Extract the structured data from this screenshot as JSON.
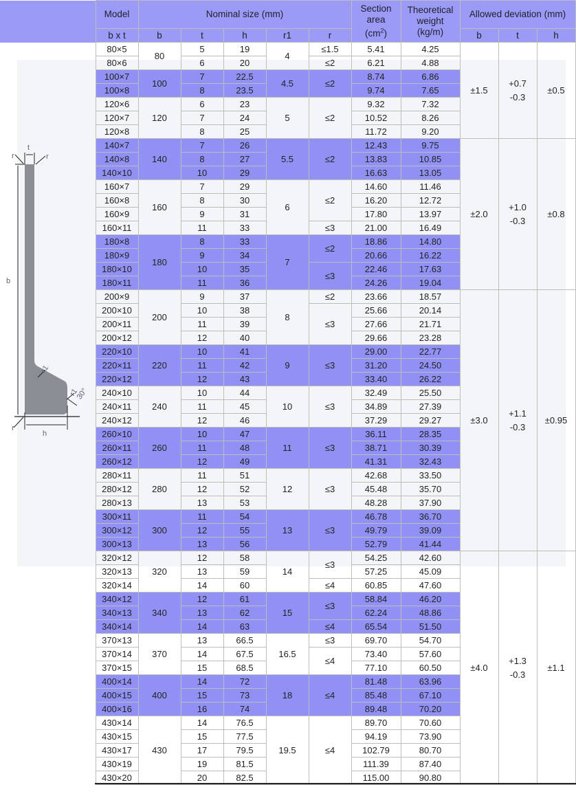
{
  "header": {
    "model": "Model",
    "nominal_size": "Nominal size (mm)",
    "section_area": [
      "Section",
      "area",
      "(cm",
      "2",
      ")"
    ],
    "theoretical_weight": [
      "Theoretical",
      "weight",
      "(kg/m)"
    ],
    "allowed_deviation": "Allowed deviation (mm)",
    "sub": {
      "bxt": "b x t",
      "b": "b",
      "t": "t",
      "h": "h",
      "r1": "r1",
      "r": "r",
      "dev_b": "b",
      "dev_t": "t",
      "dev_h": "h"
    }
  },
  "figure": {
    "labels": {
      "t": "t",
      "b": "b",
      "h": "h",
      "r": "r",
      "r1": "r1",
      "angle": "30°"
    },
    "fill_color": "#8a8d94"
  },
  "colors": {
    "header_bg": "#9b9bf7",
    "highlight_row": "#9191f5",
    "panel_bg": "#f4f5f9"
  },
  "groups": [
    {
      "b": "80",
      "r1": "4",
      "hl": false,
      "rows": [
        {
          "model": "80×5",
          "t": "5",
          "h": "19",
          "area": "5.41",
          "weight": "4.25"
        },
        {
          "model": "80×6",
          "t": "6",
          "h": "20",
          "area": "6.21",
          "weight": "4.88"
        }
      ],
      "r_spans": [
        {
          "value": "≤1.5",
          "span": 1
        },
        {
          "value": "≤2",
          "span": 1
        }
      ]
    },
    {
      "b": "100",
      "r1": "4.5",
      "hl": true,
      "rows": [
        {
          "model": "100×7",
          "t": "7",
          "h": "22.5",
          "area": "8.74",
          "weight": "6.86"
        },
        {
          "model": "100×8",
          "t": "8",
          "h": "23.5",
          "area": "9.74",
          "weight": "7.65"
        }
      ],
      "r_spans": [
        {
          "value": "≤2",
          "span": 2
        }
      ]
    },
    {
      "b": "120",
      "r1": "5",
      "hl": false,
      "rows": [
        {
          "model": "120×6",
          "t": "6",
          "h": "23",
          "area": "9.32",
          "weight": "7.32"
        },
        {
          "model": "120×7",
          "t": "7",
          "h": "24",
          "area": "10.52",
          "weight": "8.26"
        },
        {
          "model": "120×8",
          "t": "8",
          "h": "25",
          "area": "11.72",
          "weight": "9.20"
        }
      ],
      "r_spans": [
        {
          "value": "≤2",
          "span": 3
        }
      ]
    },
    {
      "b": "140",
      "r1": "5.5",
      "hl": true,
      "rows": [
        {
          "model": "140×7",
          "t": "7",
          "h": "26",
          "area": "12.43",
          "weight": "9.75"
        },
        {
          "model": "140×8",
          "t": "8",
          "h": "27",
          "area": "13.83",
          "weight": "10.85"
        },
        {
          "model": "140×10",
          "t": "10",
          "h": "29",
          "area": "16.63",
          "weight": "13.05"
        }
      ],
      "r_spans": [
        {
          "value": "≤2",
          "span": 3
        }
      ]
    },
    {
      "b": "160",
      "r1": "6",
      "hl": false,
      "rows": [
        {
          "model": "160×7",
          "t": "7",
          "h": "29",
          "area": "14.60",
          "weight": "11.46"
        },
        {
          "model": "160×8",
          "t": "8",
          "h": "30",
          "area": "16.20",
          "weight": "12.72"
        },
        {
          "model": "160×9",
          "t": "9",
          "h": "31",
          "area": "17.80",
          "weight": "13.97"
        },
        {
          "model": "160×11",
          "t": "11",
          "h": "33",
          "area": "21.00",
          "weight": "16.49"
        }
      ],
      "r_spans": [
        {
          "value": "≤2",
          "span": 3
        },
        {
          "value": "≤3",
          "span": 1
        }
      ]
    },
    {
      "b": "180",
      "r1": "7",
      "hl": true,
      "rows": [
        {
          "model": "180×8",
          "t": "8",
          "h": "33",
          "area": "18.86",
          "weight": "14.80"
        },
        {
          "model": "180×9",
          "t": "9",
          "h": "34",
          "area": "20.66",
          "weight": "16.22"
        },
        {
          "model": "180×10",
          "t": "10",
          "h": "35",
          "area": "22.46",
          "weight": "17.63"
        },
        {
          "model": "180×11",
          "t": "11",
          "h": "36",
          "area": "24.26",
          "weight": "19.04"
        }
      ],
      "r_spans": [
        {
          "value": "≤2",
          "span": 2
        },
        {
          "value": "≤3",
          "span": 2
        }
      ]
    },
    {
      "b": "200",
      "r1": "8",
      "hl": false,
      "rows": [
        {
          "model": "200×9",
          "t": "9",
          "h": "37",
          "area": "23.66",
          "weight": "18.57"
        },
        {
          "model": "200×10",
          "t": "10",
          "h": "38",
          "area": "25.66",
          "weight": "20.14"
        },
        {
          "model": "200×11",
          "t": "11",
          "h": "39",
          "area": "27.66",
          "weight": "21.71"
        },
        {
          "model": "200×12",
          "t": "12",
          "h": "40",
          "area": "29.66",
          "weight": "23.28"
        }
      ],
      "r_spans": [
        {
          "value": "≤2",
          "span": 1
        },
        {
          "value": "≤3",
          "span": 3
        }
      ]
    },
    {
      "b": "220",
      "r1": "9",
      "hl": true,
      "rows": [
        {
          "model": "220×10",
          "t": "10",
          "h": "41",
          "area": "29.00",
          "weight": "22.77"
        },
        {
          "model": "220×11",
          "t": "11",
          "h": "42",
          "area": "31.20",
          "weight": "24.50"
        },
        {
          "model": "220×12",
          "t": "12",
          "h": "43",
          "area": "33.40",
          "weight": "26.22"
        }
      ],
      "r_spans": [
        {
          "value": "≤3",
          "span": 3
        }
      ]
    },
    {
      "b": "240",
      "r1": "10",
      "hl": false,
      "rows": [
        {
          "model": "240×10",
          "t": "10",
          "h": "44",
          "area": "32.49",
          "weight": "25.50"
        },
        {
          "model": "240×11",
          "t": "11",
          "h": "45",
          "area": "34.89",
          "weight": "27.39"
        },
        {
          "model": "240×12",
          "t": "12",
          "h": "46",
          "area": "37.29",
          "weight": "29.27"
        }
      ],
      "r_spans": [
        {
          "value": "≤3",
          "span": 3
        }
      ]
    },
    {
      "b": "260",
      "r1": "11",
      "hl": true,
      "rows": [
        {
          "model": "260×10",
          "t": "10",
          "h": "47",
          "area": "36.11",
          "weight": "28.35"
        },
        {
          "model": "260×11",
          "t": "11",
          "h": "48",
          "area": "38.71",
          "weight": "30.39"
        },
        {
          "model": "260×12",
          "t": "12",
          "h": "49",
          "area": "41.31",
          "weight": "32.43"
        }
      ],
      "r_spans": [
        {
          "value": "≤3",
          "span": 3
        }
      ]
    },
    {
      "b": "280",
      "r1": "12",
      "hl": false,
      "rows": [
        {
          "model": "280×11",
          "t": "11",
          "h": "51",
          "area": "42.68",
          "weight": "33.50"
        },
        {
          "model": "280×12",
          "t": "12",
          "h": "52",
          "area": "45.48",
          "weight": "35.70"
        },
        {
          "model": "280×13",
          "t": "13",
          "h": "53",
          "area": "48.28",
          "weight": "37.90"
        }
      ],
      "r_spans": [
        {
          "value": "≤3",
          "span": 3
        }
      ]
    },
    {
      "b": "300",
      "r1": "13",
      "hl": true,
      "rows": [
        {
          "model": "300×11",
          "t": "11",
          "h": "54",
          "area": "46.78",
          "weight": "36.70"
        },
        {
          "model": "300×12",
          "t": "12",
          "h": "55",
          "area": "49.79",
          "weight": "39.09"
        },
        {
          "model": "300×13",
          "t": "13",
          "h": "56",
          "area": "52.79",
          "weight": "41.44"
        }
      ],
      "r_spans": [
        {
          "value": "≤3",
          "span": 3
        }
      ]
    },
    {
      "b": "320",
      "r1": "14",
      "hl": false,
      "rows": [
        {
          "model": "320×12",
          "t": "12",
          "h": "58",
          "area": "54.25",
          "weight": "42.60"
        },
        {
          "model": "320×13",
          "t": "13",
          "h": "59",
          "area": "57.25",
          "weight": "45.09"
        },
        {
          "model": "320×14",
          "t": "14",
          "h": "60",
          "area": "60.85",
          "weight": "47.60"
        }
      ],
      "r_spans": [
        {
          "value": "≤3",
          "span": 2
        },
        {
          "value": "≤4",
          "span": 1
        }
      ]
    },
    {
      "b": "340",
      "r1": "15",
      "hl": true,
      "rows": [
        {
          "model": "340×12",
          "t": "12",
          "h": "61",
          "area": "58.84",
          "weight": "46.20"
        },
        {
          "model": "340×13",
          "t": "13",
          "h": "62",
          "area": "62.24",
          "weight": "48.86"
        },
        {
          "model": "340×14",
          "t": "14",
          "h": "63",
          "area": "65.54",
          "weight": "51.50"
        }
      ],
      "r_spans": [
        {
          "value": "≤3",
          "span": 2
        },
        {
          "value": "≤4",
          "span": 1
        }
      ]
    },
    {
      "b": "370",
      "r1": "16.5",
      "hl": false,
      "rows": [
        {
          "model": "370×13",
          "t": "13",
          "h": "66.5",
          "area": "69.70",
          "weight": "54.70"
        },
        {
          "model": "370×14",
          "t": "14",
          "h": "67.5",
          "area": "73.40",
          "weight": "57.60"
        },
        {
          "model": "370×15",
          "t": "15",
          "h": "68.5",
          "area": "77.10",
          "weight": "60.50"
        }
      ],
      "r_spans": [
        {
          "value": "≤3",
          "span": 1
        },
        {
          "value": "≤4",
          "span": 2
        }
      ]
    },
    {
      "b": "400",
      "r1": "18",
      "hl": true,
      "rows": [
        {
          "model": "400×14",
          "t": "14",
          "h": "72",
          "area": "81.48",
          "weight": "63.96"
        },
        {
          "model": "400×15",
          "t": "15",
          "h": "73",
          "area": "85.48",
          "weight": "67.10"
        },
        {
          "model": "400×16",
          "t": "16",
          "h": "74",
          "area": "89.48",
          "weight": "70.20"
        }
      ],
      "r_spans": [
        {
          "value": "≤4",
          "span": 3
        }
      ]
    },
    {
      "b": "430",
      "r1": "19.5",
      "hl": false,
      "rows": [
        {
          "model": "430×14",
          "t": "14",
          "h": "76.5",
          "area": "89.70",
          "weight": "70.60"
        },
        {
          "model": "430×15",
          "t": "15",
          "h": "77.5",
          "area": "94.19",
          "weight": "73.90"
        },
        {
          "model": "430×17",
          "t": "17",
          "h": "79.5",
          "area": "102.79",
          "weight": "80.70"
        },
        {
          "model": "430×19",
          "t": "19",
          "h": "81.5",
          "area": "111.39",
          "weight": "87.40"
        },
        {
          "model": "430×20",
          "t": "20",
          "h": "82.5",
          "area": "115.00",
          "weight": "90.80"
        }
      ],
      "r_spans": [
        {
          "value": "≤4",
          "span": 5
        }
      ]
    }
  ],
  "deviations": [
    {
      "groups": 3,
      "b": "±1.5",
      "t_plus": "+0.7",
      "t_minus": "-0.3",
      "h": "±0.5"
    },
    {
      "groups": 3,
      "b": "±2.0",
      "t_plus": "+1.0",
      "t_minus": "-0.3",
      "h": "±0.8"
    },
    {
      "groups": 6,
      "b": "±3.0",
      "t_plus": "+1.1",
      "t_minus": "-0.3",
      "h": "±0.95"
    },
    {
      "groups": 5,
      "b": "±4.0",
      "t_plus": "+1.3",
      "t_minus": "-0.3",
      "h": "±1.1"
    }
  ]
}
